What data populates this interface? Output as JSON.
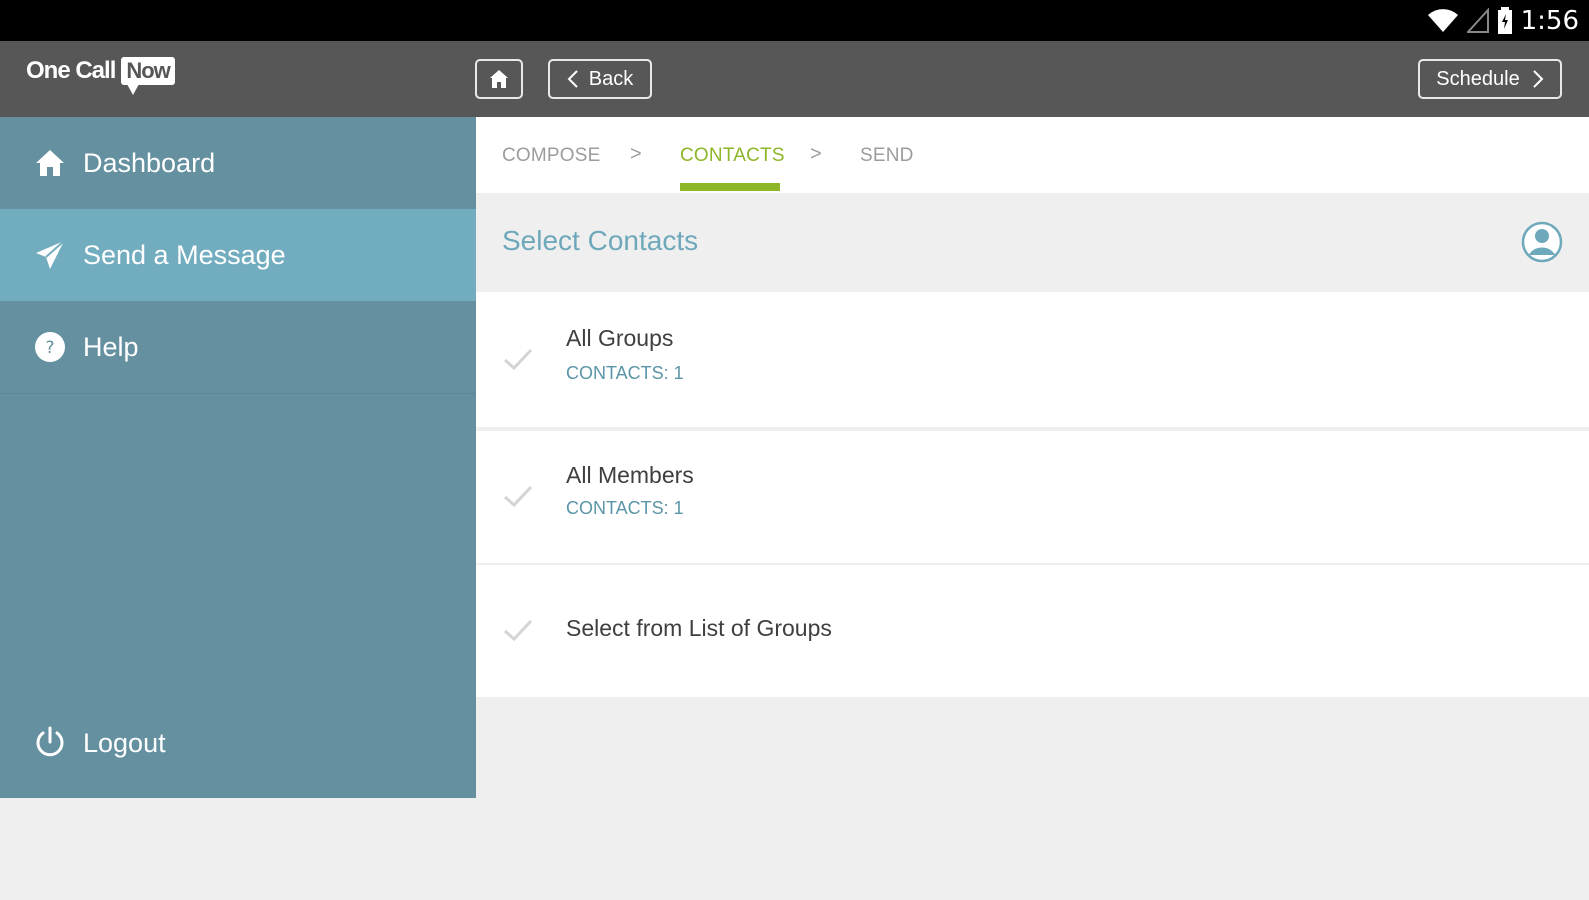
{
  "status_bar": {
    "time": "1:56",
    "icons": [
      "wifi-icon",
      "cellular-signal-icon",
      "battery-icon"
    ]
  },
  "header": {
    "logo_text_one": "One Call",
    "logo_text_now": "Now",
    "back_label": "Back",
    "schedule_label": "Schedule"
  },
  "sidebar": {
    "items": [
      {
        "label": "Dashboard",
        "icon": "home-icon"
      },
      {
        "label": "Send a Message",
        "icon": "paper-plane-icon"
      },
      {
        "label": "Help",
        "icon": "help-icon"
      }
    ],
    "logout_label": "Logout"
  },
  "steps": {
    "compose": "COMPOSE",
    "contacts": "CONTACTS",
    "send": "SEND",
    "separator": ">"
  },
  "select": {
    "title": "Select Contacts"
  },
  "rows": [
    {
      "title": "All Groups",
      "subtitle": "CONTACTS: 1"
    },
    {
      "title": "All Members",
      "subtitle": "CONTACTS: 1"
    },
    {
      "title": "Select from List of Groups"
    }
  ],
  "colors": {
    "header_bg": "#575757",
    "sidebar_bg": "#6490a0",
    "sidebar_active": "#72acbf",
    "accent_green": "#8db628",
    "accent_blue": "#6ea8bb"
  }
}
